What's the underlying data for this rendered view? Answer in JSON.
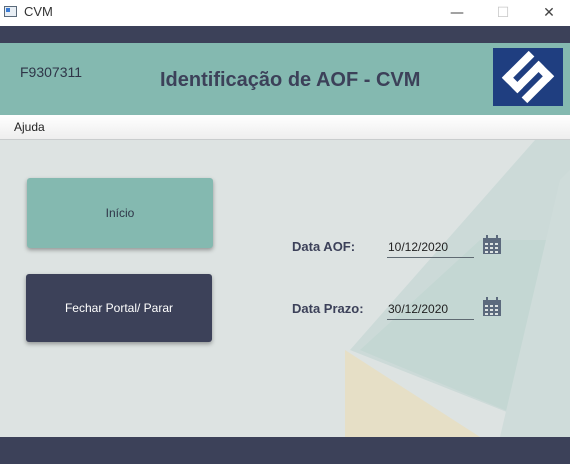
{
  "window": {
    "title": "CVM",
    "minimize_glyph": "—",
    "maximize_glyph": "☐",
    "close_glyph": "✕"
  },
  "header": {
    "user_code": "F9307311",
    "title": "Identificação de AOF - CVM",
    "logo_icon": "banco-do-brasil-logo"
  },
  "menu": {
    "items": [
      "Ajuda"
    ]
  },
  "buttons": {
    "inicio": "Início",
    "fechar": "Fechar Portal/ Parar"
  },
  "fields": {
    "data_aof": {
      "label": "Data AOF:",
      "value": "10/12/2020",
      "icon": "calendar-icon"
    },
    "data_prazo": {
      "label": "Data Prazo:",
      "value": "30/12/2020",
      "icon": "calendar-icon"
    }
  },
  "colors": {
    "dark": "#3c4159",
    "teal": "#84b9b0",
    "logo_blue": "#1f3e80",
    "logo_yellow": "#f5d000",
    "background": "#dde3e2"
  }
}
